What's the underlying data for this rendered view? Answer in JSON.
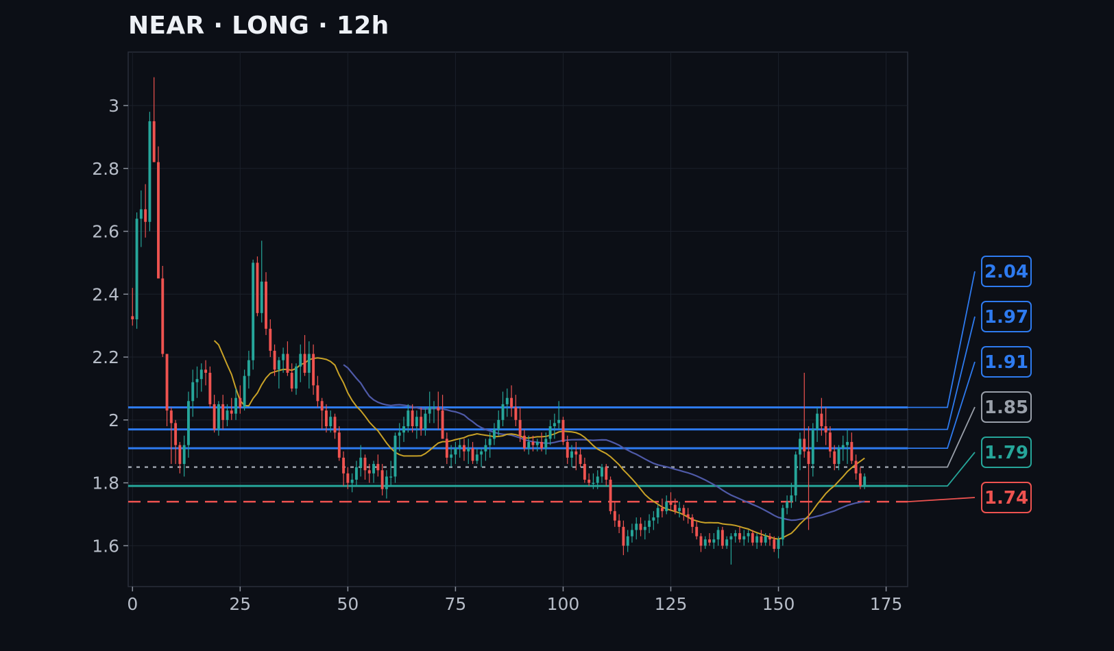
{
  "title": "NEAR · LONG · 12h",
  "chart_data": {
    "type": "candlestick",
    "title": "NEAR · LONG · 12h",
    "xlim": [
      -1,
      180
    ],
    "ylim": [
      1.47,
      3.17
    ],
    "x_ticks": [
      0,
      25,
      50,
      75,
      100,
      125,
      150,
      175
    ],
    "y_ticks": [
      1.6,
      1.8,
      2.0,
      2.2,
      2.4,
      2.6,
      2.8,
      3.0
    ],
    "y_tick_labels": [
      "1.6",
      "1.8",
      "2",
      "2.2",
      "2.4",
      "2.6",
      "2.8",
      "3"
    ],
    "grid": true,
    "colors": {
      "up": "#26a69a",
      "down": "#ef5350",
      "ma_fast": "#c9a227",
      "ma_slow": "#4f5aa8",
      "take_profit": "#2e7bf0",
      "entry": "#9aa0aa",
      "stop": "#ef5350",
      "support": "#26a69a"
    },
    "candles": [
      [
        2.33,
        2.42,
        2.3,
        2.32
      ],
      [
        2.32,
        2.66,
        2.29,
        2.64
      ],
      [
        2.64,
        2.73,
        2.55,
        2.67
      ],
      [
        2.67,
        2.75,
        2.58,
        2.63
      ],
      [
        2.63,
        2.98,
        2.6,
        2.95
      ],
      [
        2.95,
        3.09,
        2.82,
        2.82
      ],
      [
        2.82,
        2.87,
        2.46,
        2.45
      ],
      [
        2.45,
        2.49,
        2.2,
        2.21
      ],
      [
        2.21,
        2.21,
        1.98,
        2.03
      ],
      [
        2.03,
        2.04,
        1.86,
        1.99
      ],
      [
        1.99,
        2.0,
        1.86,
        1.92
      ],
      [
        1.92,
        1.93,
        1.83,
        1.86
      ],
      [
        1.86,
        1.95,
        1.82,
        1.92
      ],
      [
        1.92,
        2.09,
        1.88,
        2.06
      ],
      [
        2.06,
        2.16,
        2.01,
        2.12
      ],
      [
        2.12,
        2.17,
        2.07,
        2.13
      ],
      [
        2.13,
        2.18,
        2.09,
        2.16
      ],
      [
        2.16,
        2.19,
        2.11,
        2.15
      ],
      [
        2.15,
        2.17,
        2.04,
        2.05
      ],
      [
        2.05,
        2.08,
        1.96,
        1.97
      ],
      [
        1.97,
        2.06,
        1.95,
        2.05
      ],
      [
        2.05,
        2.08,
        1.97,
        2.0
      ],
      [
        2.0,
        2.05,
        1.98,
        2.03
      ],
      [
        2.03,
        2.07,
        2.0,
        2.02
      ],
      [
        2.02,
        2.1,
        2.0,
        2.07
      ],
      [
        2.07,
        2.11,
        2.02,
        2.04
      ],
      [
        2.04,
        2.16,
        2.03,
        2.14
      ],
      [
        2.14,
        2.22,
        2.1,
        2.19
      ],
      [
        2.19,
        2.51,
        2.16,
        2.5
      ],
      [
        2.5,
        2.52,
        2.33,
        2.34
      ],
      [
        2.34,
        2.57,
        2.31,
        2.44
      ],
      [
        2.44,
        2.47,
        2.27,
        2.29
      ],
      [
        2.29,
        2.32,
        2.2,
        2.22
      ],
      [
        2.22,
        2.24,
        2.14,
        2.16
      ],
      [
        2.16,
        2.2,
        2.1,
        2.19
      ],
      [
        2.19,
        2.23,
        2.15,
        2.21
      ],
      [
        2.21,
        2.25,
        2.14,
        2.15
      ],
      [
        2.15,
        2.18,
        2.09,
        2.1
      ],
      [
        2.1,
        2.18,
        2.08,
        2.17
      ],
      [
        2.17,
        2.24,
        2.12,
        2.21
      ],
      [
        2.21,
        2.27,
        2.14,
        2.15
      ],
      [
        2.15,
        2.25,
        2.1,
        2.21
      ],
      [
        2.21,
        2.24,
        2.08,
        2.11
      ],
      [
        2.11,
        2.14,
        2.04,
        2.06
      ],
      [
        2.06,
        2.07,
        1.97,
        2.03
      ],
      [
        2.03,
        2.05,
        1.96,
        1.98
      ],
      [
        1.98,
        2.03,
        1.96,
        2.01
      ],
      [
        2.01,
        2.02,
        1.94,
        1.96
      ],
      [
        1.96,
        1.98,
        1.87,
        1.88
      ],
      [
        1.88,
        1.9,
        1.79,
        1.83
      ],
      [
        1.83,
        1.85,
        1.78,
        1.8
      ],
      [
        1.8,
        1.83,
        1.77,
        1.81
      ],
      [
        1.81,
        1.87,
        1.79,
        1.85
      ],
      [
        1.85,
        1.92,
        1.82,
        1.88
      ],
      [
        1.88,
        1.89,
        1.81,
        1.84
      ],
      [
        1.84,
        1.86,
        1.8,
        1.83
      ],
      [
        1.83,
        1.87,
        1.8,
        1.86
      ],
      [
        1.86,
        1.89,
        1.82,
        1.84
      ],
      [
        1.84,
        1.86,
        1.76,
        1.78
      ],
      [
        1.78,
        1.84,
        1.75,
        1.82
      ],
      [
        1.82,
        1.87,
        1.79,
        1.82
      ],
      [
        1.82,
        1.96,
        1.8,
        1.95
      ],
      [
        1.95,
        1.99,
        1.9,
        1.96
      ],
      [
        1.96,
        2.01,
        1.93,
        1.98
      ],
      [
        1.98,
        2.05,
        1.96,
        2.03
      ],
      [
        2.03,
        2.05,
        1.96,
        1.98
      ],
      [
        1.98,
        2.03,
        1.94,
        2.01
      ],
      [
        2.01,
        2.04,
        1.95,
        1.97
      ],
      [
        1.97,
        2.04,
        1.95,
        2.02
      ],
      [
        2.02,
        2.09,
        1.99,
        2.04
      ],
      [
        2.04,
        2.06,
        1.99,
        2.04
      ],
      [
        2.04,
        2.09,
        1.97,
        2.03
      ],
      [
        2.03,
        2.08,
        1.94,
        1.94
      ],
      [
        1.94,
        1.96,
        1.86,
        1.88
      ],
      [
        1.88,
        1.92,
        1.85,
        1.89
      ],
      [
        1.89,
        1.93,
        1.86,
        1.91
      ],
      [
        1.91,
        1.94,
        1.88,
        1.92
      ],
      [
        1.92,
        1.94,
        1.87,
        1.9
      ],
      [
        1.9,
        1.94,
        1.86,
        1.91
      ],
      [
        1.91,
        1.93,
        1.86,
        1.87
      ],
      [
        1.87,
        1.91,
        1.86,
        1.89
      ],
      [
        1.89,
        1.91,
        1.85,
        1.9
      ],
      [
        1.9,
        1.94,
        1.87,
        1.92
      ],
      [
        1.92,
        1.96,
        1.88,
        1.94
      ],
      [
        1.94,
        1.99,
        1.92,
        1.97
      ],
      [
        1.97,
        2.03,
        1.95,
        2.0
      ],
      [
        2.0,
        2.09,
        1.98,
        2.05
      ],
      [
        2.05,
        2.1,
        2.01,
        2.07
      ],
      [
        2.07,
        2.11,
        2.01,
        2.04
      ],
      [
        2.04,
        2.08,
        1.98,
        2.0
      ],
      [
        2.0,
        2.04,
        1.93,
        1.95
      ],
      [
        1.95,
        1.97,
        1.9,
        1.91
      ],
      [
        1.91,
        1.95,
        1.89,
        1.93
      ],
      [
        1.93,
        1.95,
        1.9,
        1.92
      ],
      [
        1.92,
        1.94,
        1.9,
        1.93
      ],
      [
        1.93,
        1.96,
        1.9,
        1.91
      ],
      [
        1.91,
        1.96,
        1.89,
        1.94
      ],
      [
        1.94,
        2.0,
        1.92,
        1.98
      ],
      [
        1.98,
        2.02,
        1.94,
        1.99
      ],
      [
        1.99,
        2.06,
        1.97,
        2.0
      ],
      [
        2.0,
        2.01,
        1.92,
        1.93
      ],
      [
        1.93,
        1.95,
        1.86,
        1.88
      ],
      [
        1.88,
        1.92,
        1.85,
        1.9
      ],
      [
        1.9,
        1.93,
        1.84,
        1.89
      ],
      [
        1.89,
        1.91,
        1.85,
        1.86
      ],
      [
        1.86,
        1.88,
        1.8,
        1.81
      ],
      [
        1.81,
        1.83,
        1.79,
        1.8
      ],
      [
        1.8,
        1.83,
        1.78,
        1.8
      ],
      [
        1.8,
        1.84,
        1.78,
        1.82
      ],
      [
        1.82,
        1.86,
        1.8,
        1.85
      ],
      [
        1.85,
        1.86,
        1.79,
        1.81
      ],
      [
        1.81,
        1.82,
        1.7,
        1.71
      ],
      [
        1.71,
        1.74,
        1.66,
        1.68
      ],
      [
        1.68,
        1.7,
        1.64,
        1.66
      ],
      [
        1.66,
        1.68,
        1.57,
        1.6
      ],
      [
        1.6,
        1.65,
        1.58,
        1.63
      ],
      [
        1.63,
        1.67,
        1.61,
        1.65
      ],
      [
        1.65,
        1.69,
        1.62,
        1.67
      ],
      [
        1.67,
        1.69,
        1.63,
        1.65
      ],
      [
        1.65,
        1.68,
        1.62,
        1.66
      ],
      [
        1.66,
        1.7,
        1.64,
        1.68
      ],
      [
        1.68,
        1.71,
        1.65,
        1.69
      ],
      [
        1.69,
        1.73,
        1.67,
        1.72
      ],
      [
        1.72,
        1.75,
        1.69,
        1.71
      ],
      [
        1.71,
        1.76,
        1.7,
        1.74
      ],
      [
        1.74,
        1.77,
        1.71,
        1.73
      ],
      [
        1.73,
        1.75,
        1.7,
        1.71
      ],
      [
        1.71,
        1.74,
        1.69,
        1.72
      ],
      [
        1.72,
        1.73,
        1.68,
        1.7
      ],
      [
        1.7,
        1.72,
        1.67,
        1.69
      ],
      [
        1.69,
        1.7,
        1.64,
        1.66
      ],
      [
        1.66,
        1.68,
        1.62,
        1.63
      ],
      [
        1.63,
        1.64,
        1.58,
        1.6
      ],
      [
        1.6,
        1.63,
        1.59,
        1.62
      ],
      [
        1.62,
        1.64,
        1.6,
        1.61
      ],
      [
        1.61,
        1.64,
        1.59,
        1.62
      ],
      [
        1.62,
        1.66,
        1.6,
        1.65
      ],
      [
        1.65,
        1.66,
        1.59,
        1.6
      ],
      [
        1.6,
        1.63,
        1.59,
        1.62
      ],
      [
        1.62,
        1.64,
        1.54,
        1.63
      ],
      [
        1.63,
        1.65,
        1.61,
        1.64
      ],
      [
        1.64,
        1.66,
        1.61,
        1.62
      ],
      [
        1.62,
        1.65,
        1.6,
        1.63
      ],
      [
        1.63,
        1.65,
        1.61,
        1.64
      ],
      [
        1.64,
        1.65,
        1.6,
        1.61
      ],
      [
        1.61,
        1.64,
        1.59,
        1.63
      ],
      [
        1.63,
        1.65,
        1.6,
        1.61
      ],
      [
        1.61,
        1.64,
        1.6,
        1.63
      ],
      [
        1.63,
        1.64,
        1.6,
        1.62
      ],
      [
        1.62,
        1.63,
        1.58,
        1.59
      ],
      [
        1.59,
        1.63,
        1.56,
        1.62
      ],
      [
        1.62,
        1.73,
        1.6,
        1.72
      ],
      [
        1.72,
        1.76,
        1.7,
        1.74
      ],
      [
        1.74,
        1.8,
        1.72,
        1.76
      ],
      [
        1.76,
        1.9,
        1.74,
        1.89
      ],
      [
        1.89,
        1.96,
        1.84,
        1.94
      ],
      [
        1.94,
        2.15,
        1.88,
        1.9
      ],
      [
        1.9,
        1.98,
        1.65,
        1.86
      ],
      [
        1.86,
        1.99,
        1.82,
        1.97
      ],
      [
        1.97,
        2.04,
        1.93,
        2.02
      ],
      [
        2.02,
        2.07,
        1.95,
        1.98
      ],
      [
        1.98,
        2.04,
        1.92,
        1.96
      ],
      [
        1.96,
        1.98,
        1.88,
        1.9
      ],
      [
        1.9,
        1.92,
        1.84,
        1.86
      ],
      [
        1.86,
        1.92,
        1.84,
        1.91
      ],
      [
        1.91,
        1.95,
        1.87,
        1.92
      ],
      [
        1.92,
        1.97,
        1.86,
        1.93
      ],
      [
        1.93,
        1.96,
        1.86,
        1.87
      ],
      [
        1.87,
        1.89,
        1.81,
        1.83
      ],
      [
        1.83,
        1.85,
        1.78,
        1.79
      ],
      [
        1.79,
        1.83,
        1.78,
        1.82
      ]
    ],
    "ma_fast": {
      "start": 19,
      "period": 20
    },
    "ma_slow": {
      "start": 49,
      "period": 50
    },
    "levels": [
      {
        "name": "take-profit-3",
        "value": 2.04,
        "label": "2.04",
        "style": "solid",
        "color": "#2e7bf0"
      },
      {
        "name": "take-profit-2",
        "value": 1.97,
        "label": "1.97",
        "style": "solid",
        "color": "#2e7bf0"
      },
      {
        "name": "take-profit-1",
        "value": 1.91,
        "label": "1.91",
        "style": "solid",
        "color": "#2e7bf0"
      },
      {
        "name": "entry",
        "value": 1.85,
        "label": "1.85",
        "style": "dotted",
        "color": "#9aa0aa"
      },
      {
        "name": "support",
        "value": 1.79,
        "label": "1.79",
        "style": "solid",
        "color": "#26a69a"
      },
      {
        "name": "stop-loss",
        "value": 1.74,
        "label": "1.74",
        "style": "dashed",
        "color": "#ef5350"
      }
    ]
  }
}
